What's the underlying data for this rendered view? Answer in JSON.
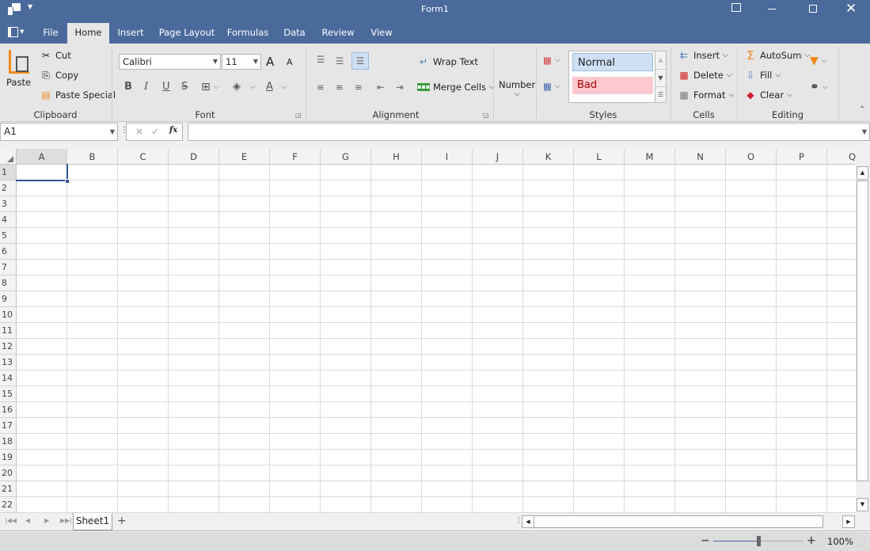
{
  "window": {
    "title": "Form1",
    "controls": [
      "restore-ribbon",
      "minimize",
      "maximize",
      "close"
    ]
  },
  "ribbon_tabs": [
    {
      "label": "File"
    },
    {
      "label": "Home"
    },
    {
      "label": "Insert"
    },
    {
      "label": "Page Layout"
    },
    {
      "label": "Formulas"
    },
    {
      "label": "Data"
    },
    {
      "label": "Review"
    },
    {
      "label": "View"
    }
  ],
  "active_tab": "Home",
  "clipboard": {
    "paste": "Paste",
    "cut": "Cut",
    "copy": "Copy",
    "paste_special": "Paste Special",
    "label": "Clipboard"
  },
  "font": {
    "name": "Calibri",
    "size": "11",
    "label": "Font",
    "bold": "B",
    "italic": "I",
    "underline": "U",
    "strike": "S",
    "grow": "A",
    "shrink": "A",
    "color": "A"
  },
  "alignment": {
    "wrap_text": "Wrap Text",
    "merge_cells": "Merge Cells",
    "label": "Alignment"
  },
  "number": {
    "label": "Number"
  },
  "styles": {
    "normal": "Normal",
    "bad": "Bad",
    "label": "Styles",
    "bad_bg": "#ffc7ce",
    "bad_fg": "#9c0006",
    "normal_bg": "#cfe0f5"
  },
  "cells": {
    "insert": "Insert",
    "delete": "Delete",
    "format": "Format",
    "label": "Cells"
  },
  "editing": {
    "autosum": "AutoSum",
    "fill": "Fill",
    "clear": "Clear",
    "label": "Editing"
  },
  "formula_bar": {
    "name_box": "A1",
    "formula": "",
    "cancel": "×",
    "enter": "✓",
    "fx": "fx"
  },
  "grid": {
    "columns": [
      "A",
      "B",
      "C",
      "D",
      "E",
      "F",
      "G",
      "H",
      "I",
      "J",
      "K",
      "L",
      "M",
      "N",
      "O",
      "P",
      "Q"
    ],
    "rows": [
      "1",
      "2",
      "3",
      "4",
      "5",
      "6",
      "7",
      "8",
      "9",
      "10",
      "11",
      "12",
      "13",
      "14",
      "15",
      "16",
      "17",
      "18",
      "19",
      "20",
      "21",
      "22"
    ],
    "selected_cell": "A1"
  },
  "sheets": [
    {
      "name": "Sheet1",
      "active": true
    }
  ],
  "add_sheet": "+",
  "status": {
    "zoom": "100%",
    "zoom_minus": "−",
    "zoom_plus": "+",
    "zoom_fraction": 0.5
  },
  "colors": {
    "accent": "#4a6a9c",
    "selection": "#2f5597"
  }
}
